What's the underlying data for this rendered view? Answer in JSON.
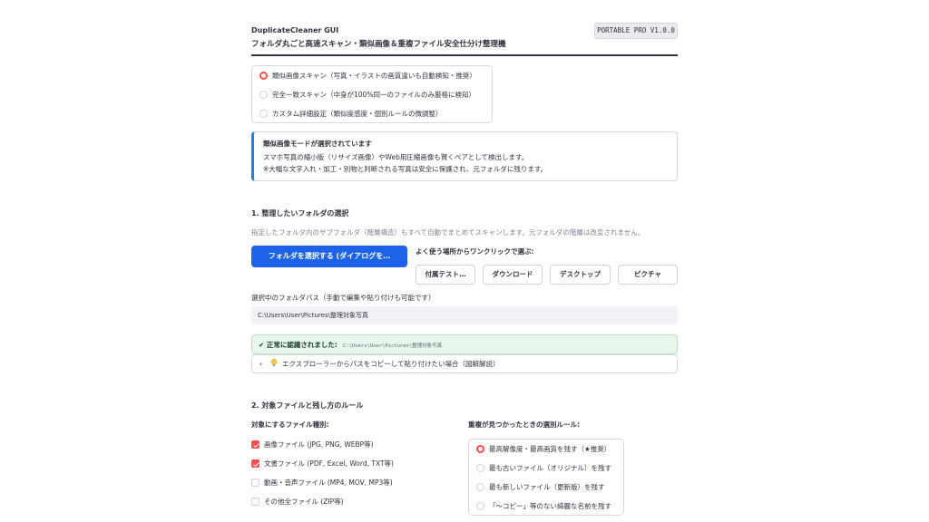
{
  "header": {
    "app_title": "DuplicateCleaner GUI",
    "subtitle": "フォルダ丸ごと高速スキャン・類似画像＆重複ファイル安全仕分け整理機",
    "version": "PORTABLE PRO V1.0.0"
  },
  "scan_modes": {
    "selected_index": 0,
    "options": [
      "類似画像スキャン（写真・イラストの画質違いも自動検知・推奨）",
      "完全一致スキャン（中身が100%同一のファイルのみ厳格に検知）",
      "カスタム詳細設定（類似度感度・個別ルールの微調整）"
    ]
  },
  "info": {
    "title": "類似画像モードが選択されています",
    "line1": "スマホ写真の縮小版（リサイズ画像）やWeb用圧縮画像も賢くペアとして検出します。",
    "line2": "※大幅な文字入れ・加工・別物と判断される写真は安全に保護され、元フォルダに残ります。"
  },
  "section1": {
    "title": "1. 整理したいフォルダの選択",
    "caption": "指定したフォルダ内のサブフォルダ（階層構造）もすべて自動でまとめてスキャンします。元フォルダの階層は改変されません。",
    "select_button": "フォルダを選択する (ダイアログを…",
    "quick_label": "よく使う場所からワンクリックで選ぶ:",
    "quick_buttons": [
      "付属テスト…",
      "ダウンロード",
      "デスクトップ",
      "ピクチャ"
    ],
    "path_label": "選択中のフォルダパス（手動で編集や貼り付けも可能です）",
    "path_value": "C:\\Users\\User\\Pictures\\整理対象写真",
    "success_label": "✔ 正常に認識されました:",
    "success_path": "C:\\Users\\User\\Pictures\\整理対象写真",
    "expander_label": "エクスプローラーからパスをコピーして貼り付けたい場合（図解解説）"
  },
  "section2": {
    "title": "2. 対象ファイルと残し方のルール",
    "file_types_label": "対象にするファイル種別:",
    "file_types": [
      {
        "label": "画像ファイル (JPG, PNG, WEBP等)",
        "checked": true
      },
      {
        "label": "文書ファイル (PDF, Excel, Word, TXT等)",
        "checked": true
      },
      {
        "label": "動画・音声ファイル (MP4, MOV, MP3等)",
        "checked": false
      },
      {
        "label": "その他全ファイル (ZIP等)",
        "checked": false
      }
    ],
    "rule_label": "重複が見つかったときの選別ルール:",
    "rule_selected_index": 0,
    "rules": [
      "最高解像度・最高画質を残す（★推奨）",
      "最も古いファイル（オリジナル）を残す",
      "最も新しいファイル（更新版）を残す",
      "「〜コピー」等のない綺麗な名前を残す"
    ]
  },
  "colors": {
    "primary": "#1d63ea",
    "accent_red": "#ff4b4b",
    "info_border": "#1c83e1",
    "success_bg": "#e8f6ec"
  }
}
